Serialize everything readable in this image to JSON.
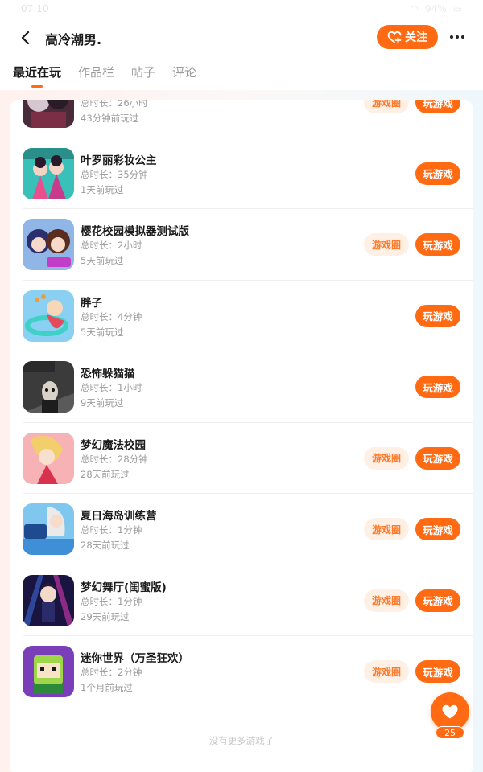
{
  "status": {
    "time": "07:10",
    "battery": "94%"
  },
  "header": {
    "username": "高冷潮男.",
    "follow_label": "关注"
  },
  "tabs": [
    {
      "label": "最近在玩"
    },
    {
      "label": "作品栏"
    },
    {
      "label": "帖子"
    },
    {
      "label": "评论"
    }
  ],
  "games": [
    {
      "title": "",
      "duration": "总时长：26小时",
      "last_played": "43分钟前玩过",
      "has_circle": true
    },
    {
      "title": "叶罗丽彩妆公主",
      "duration": "总时长：35分钟",
      "last_played": "1天前玩过",
      "has_circle": false
    },
    {
      "title": "樱花校园模拟器测试版",
      "duration": "总时长：2小时",
      "last_played": "5天前玩过",
      "has_circle": true
    },
    {
      "title": "胖子",
      "duration": "总时长：4分钟",
      "last_played": "5天前玩过",
      "has_circle": false
    },
    {
      "title": "恐怖躲猫猫",
      "duration": "总时长：1小时",
      "last_played": "9天前玩过",
      "has_circle": false
    },
    {
      "title": "梦幻魔法校园",
      "duration": "总时长：28分钟",
      "last_played": "28天前玩过",
      "has_circle": true
    },
    {
      "title": "夏日海岛训练营",
      "duration": "总时长：1分钟",
      "last_played": "28天前玩过",
      "has_circle": true
    },
    {
      "title": "梦幻舞厅(闺蜜版)",
      "duration": "总时长：1分钟",
      "last_played": "29天前玩过",
      "has_circle": true
    },
    {
      "title": "迷你世界（万圣狂欢）",
      "duration": "总时长：2分钟",
      "last_played": "1个月前玩过",
      "has_circle": true
    }
  ],
  "labels": {
    "circle": "游戏圈",
    "play": "玩游戏",
    "no_more": "没有更多游戏了"
  },
  "fab": {
    "count": "25"
  },
  "colors": {
    "accent": "#ff6a13",
    "circle_bg": "#fff0e6"
  }
}
